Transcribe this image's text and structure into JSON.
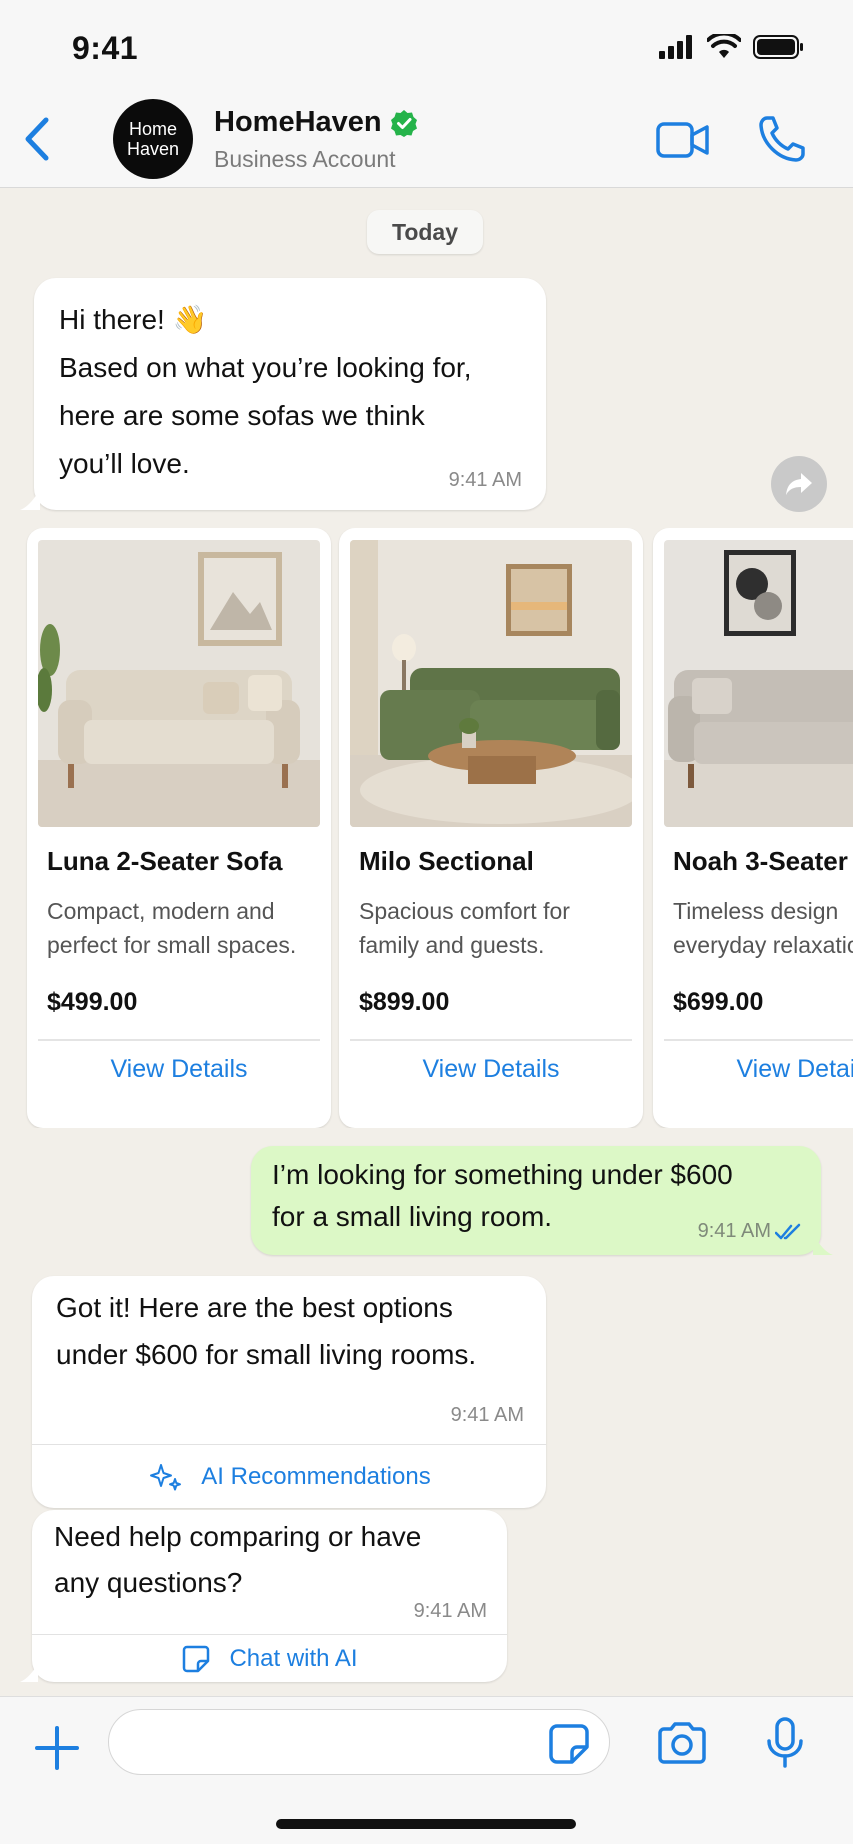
{
  "status_bar": {
    "time": "9:41"
  },
  "header": {
    "avatar_line1": "Home",
    "avatar_line2": "Haven",
    "name": "HomeHaven",
    "subtitle": "Business Account",
    "verified_icon": "verified-badge-icon"
  },
  "chat": {
    "date_chip": "Today",
    "messages": [
      {
        "lines": [
          "Hi there! 👋",
          "Based on what you’re looking for,",
          "here are some sofas we think",
          "you’ll love."
        ],
        "time": "9:41 AM"
      }
    ],
    "products": [
      {
        "name": "Luna 2-Seater Sofa",
        "desc_line1": "Compact, modern and",
        "desc_line2": "perfect for small spaces.",
        "price": "$499.00",
        "link": "View Details",
        "color": "#e8e1d4"
      },
      {
        "name": "Milo Sectional",
        "desc_line1": "Spacious comfort for",
        "desc_line2": "family and guests.",
        "price": "$899.00",
        "link": "View Details",
        "color": "#5f7448"
      },
      {
        "name": "Noah 3-Seater",
        "desc_line1": "Timeless design",
        "desc_line2": "everyday relaxation.",
        "price": "$699.00",
        "link": "View Details",
        "color": "#c9c4bd"
      }
    ],
    "outgoing": {
      "line1": "I’m looking for something under $600",
      "line2": "for a small living room.",
      "time": "9:41 AM"
    },
    "reply": {
      "line1": "Got it! Here are the best options",
      "line2": "under $600 for small living rooms.",
      "time": "9:41 AM",
      "action": "AI Recommendations"
    },
    "followup": {
      "line1": "Need help comparing or have",
      "line2": "any questions?",
      "time": "9:41 AM",
      "action": "Chat with AI"
    }
  },
  "input": {
    "placeholder": "",
    "value": ""
  },
  "colors": {
    "accent": "#1d7fe0",
    "outgoing_bubble": "#dcf8c6",
    "verified": "#25b34a"
  }
}
